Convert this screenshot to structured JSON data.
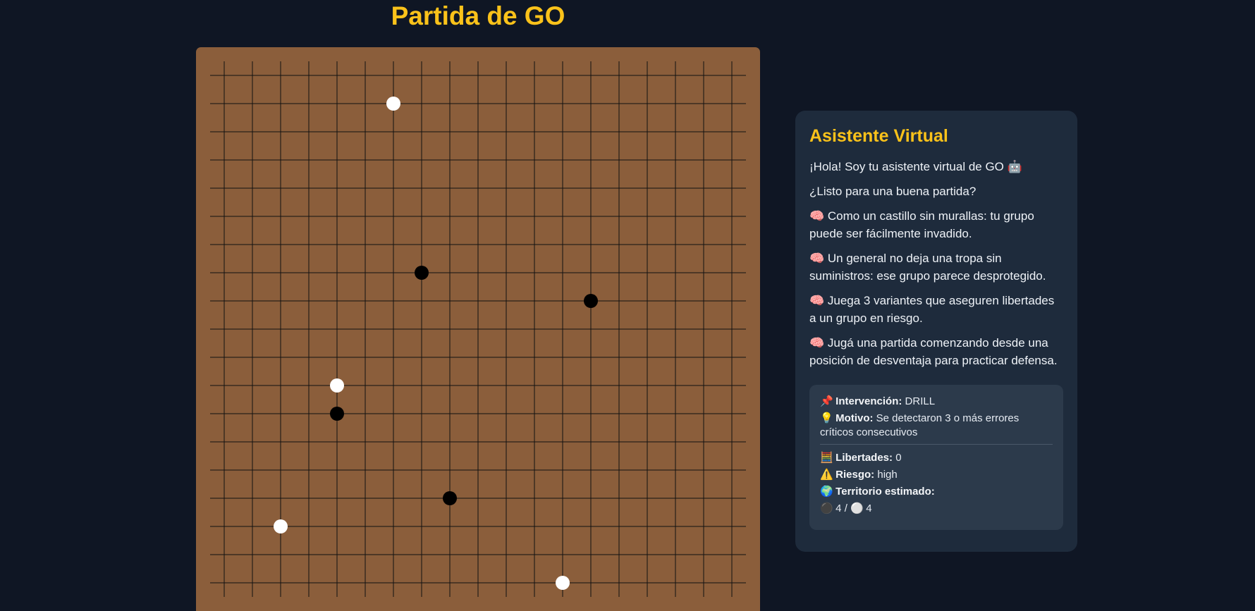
{
  "title": "Partida de GO",
  "board": {
    "size": 19,
    "stones": [
      {
        "color": "white",
        "col": 6,
        "row": 1
      },
      {
        "color": "black",
        "col": 7,
        "row": 7
      },
      {
        "color": "black",
        "col": 13,
        "row": 8
      },
      {
        "color": "white",
        "col": 4,
        "row": 11
      },
      {
        "color": "black",
        "col": 4,
        "row": 12
      },
      {
        "color": "black",
        "col": 8,
        "row": 15
      },
      {
        "color": "white",
        "col": 2,
        "row": 16
      },
      {
        "color": "white",
        "col": 12,
        "row": 18
      }
    ]
  },
  "assistant": {
    "title": "Asistente Virtual",
    "messages": [
      "¡Hola! Soy tu asistente virtual de GO 🤖",
      "¿Listo para una buena partida?",
      "🧠 Como un castillo sin murallas: tu grupo puede ser fácilmente invadido.",
      "🧠 Un general no deja una tropa sin suministros: ese grupo parece desprotegido.",
      "🧠 Juega 3 variantes que aseguren libertades a un grupo en riesgo.",
      "🧠 Jugá una partida comenzando desde una posición de desventaja para practicar defensa."
    ],
    "info": {
      "intervencion_icon": "📌",
      "intervencion_label": "Intervención:",
      "intervencion_value": "DRILL",
      "motivo_icon": "💡",
      "motivo_label": "Motivo:",
      "motivo_value": "Se detectaron 3 o más errores críticos consecutivos",
      "libertades_icon": "🧮",
      "libertades_label": "Libertades:",
      "libertades_value": "0",
      "riesgo_icon": "⚠️",
      "riesgo_label": "Riesgo:",
      "riesgo_value": "high",
      "territorio_icon": "🌍",
      "territorio_label": "Territorio estimado:",
      "territorio_black_icon": "⚫",
      "territorio_black": "4",
      "territorio_sep": "/",
      "territorio_white_icon": "⚪",
      "territorio_white": "4"
    }
  }
}
